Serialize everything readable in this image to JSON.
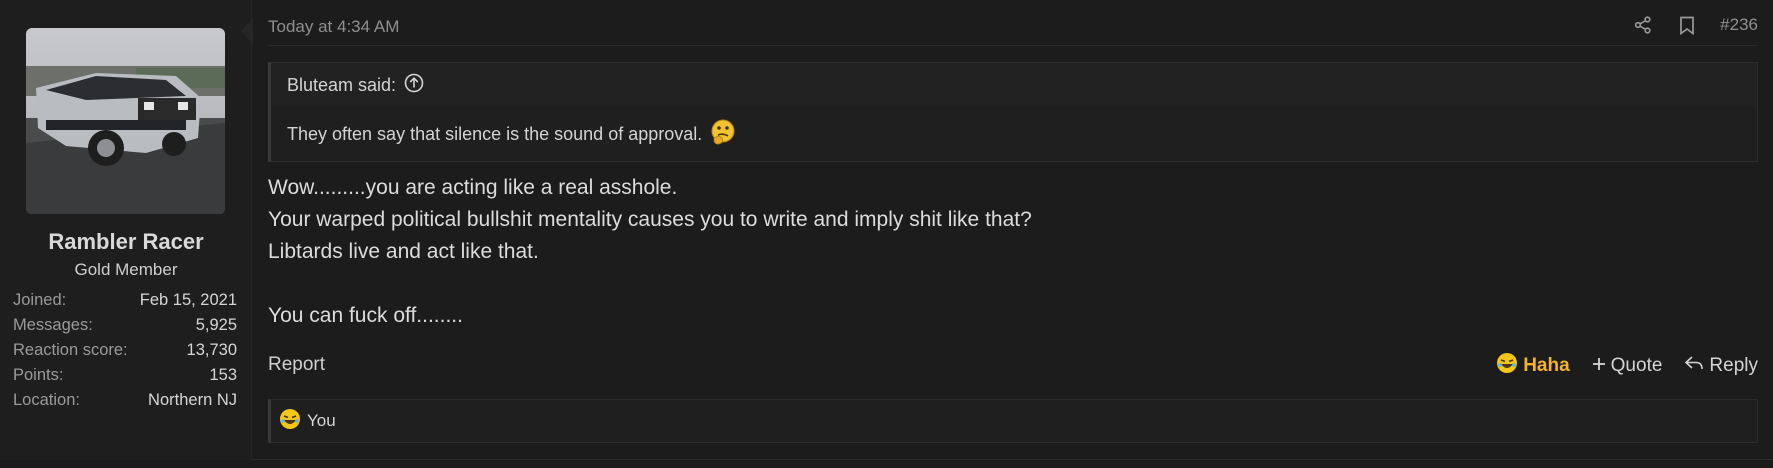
{
  "user": {
    "name": "Rambler Racer",
    "title": "Gold Member",
    "stats": [
      {
        "label": "Joined:",
        "value": "Feb 15, 2021"
      },
      {
        "label": "Messages:",
        "value": "5,925"
      },
      {
        "label": "Reaction score:",
        "value": "13,730"
      },
      {
        "label": "Points:",
        "value": "153"
      },
      {
        "label": "Location:",
        "value": "Northern NJ"
      }
    ]
  },
  "post": {
    "timestamp": "Today at 4:34 AM",
    "number": "#236",
    "quote": {
      "author": "Bluteam said:",
      "text": "They often say that silence is the sound of approval."
    },
    "lines": [
      "Wow.........you are acting like a real asshole.",
      "Your warped political bullshit mentality causes you to write and imply shit like that?",
      "Libtards live and act like that.",
      "",
      "You can fuck off........"
    ]
  },
  "footer": {
    "report": "Report",
    "haha": "Haha",
    "quote": "Quote",
    "reply": "Reply"
  },
  "reactions": {
    "text": "You"
  },
  "icons": {
    "share": "share-icon",
    "bookmark": "bookmark-icon",
    "quote_up": "arrow-up-circle-icon",
    "laugh": "laughing-emoji-icon",
    "thinking": "thinking-emoji-icon"
  },
  "colors": {
    "accent_haha": "#f2b233"
  }
}
